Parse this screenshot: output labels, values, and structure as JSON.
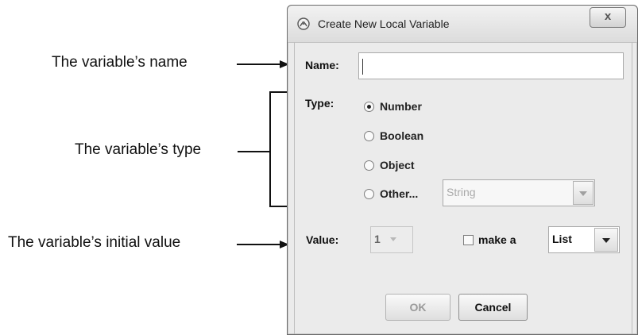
{
  "annotations": {
    "name": "The variable’s name",
    "type": "The variable’s type",
    "initial_value": "The variable’s initial value"
  },
  "dialog": {
    "title": "Create New Local Variable",
    "close_glyph": "x",
    "name_label": "Name:",
    "name_value": "",
    "type_label": "Type:",
    "types": [
      "Number",
      "Boolean",
      "Object",
      "Other..."
    ],
    "selected_type": "Number",
    "other_type_value": "String",
    "value_label": "Value:",
    "value": "1",
    "make_list_label": "make a",
    "make_list_checked": false,
    "list_option": "List",
    "ok_label": "OK",
    "cancel_label": "Cancel"
  },
  "icons": [
    "app-icon",
    "close-icon",
    "chevron-down-icon"
  ]
}
